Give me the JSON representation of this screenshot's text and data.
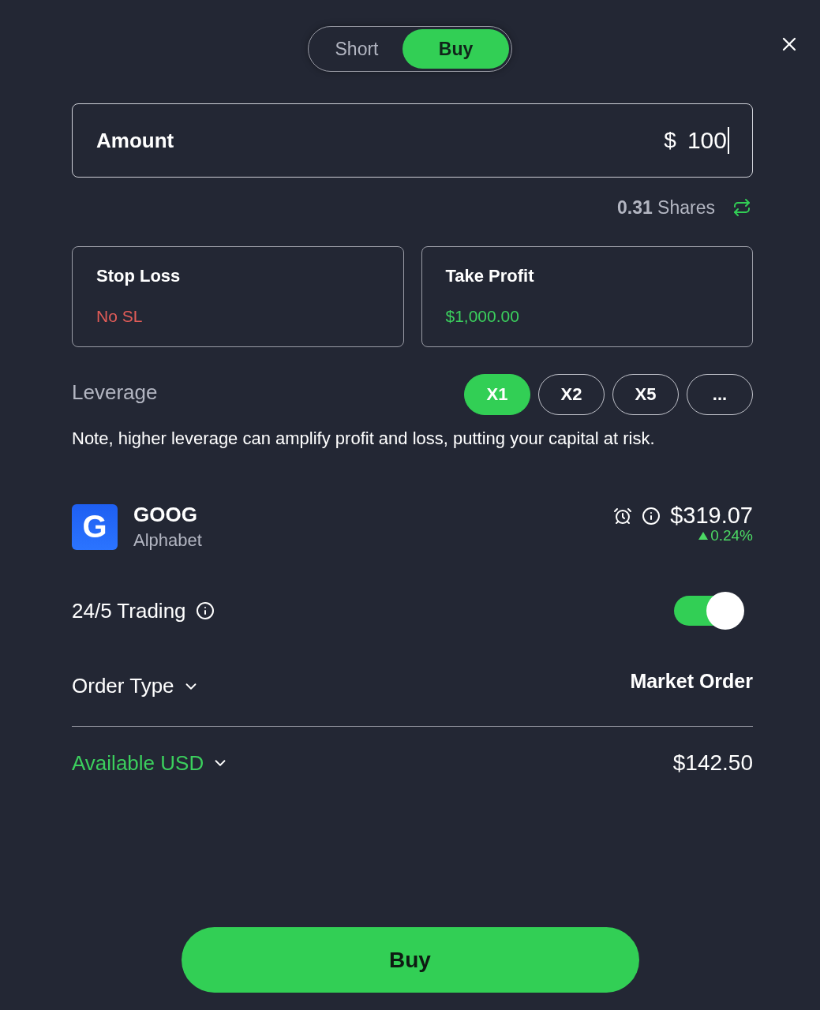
{
  "side_toggle": [
    {
      "label": "Short",
      "selected": false
    },
    {
      "label": "Buy",
      "selected": true
    }
  ],
  "amount": {
    "label": "Amount",
    "currency": "$",
    "value": "100",
    "focused": true
  },
  "shares": {
    "text": "**0.31** Shares"
  },
  "orders": [
    {
      "kind": "stop_loss",
      "title": "Stop Loss",
      "value": "No SL"
    },
    {
      "kind": "take_profit",
      "title": "Take Profit",
      "value": "$1,000.00"
    }
  ],
  "leverage": {
    "label": "Leverage",
    "options": [
      {
        "label": "X1",
        "selected": true
      },
      {
        "label": "X2",
        "selected": false
      },
      {
        "label": "X5",
        "selected": false
      },
      {
        "label": "...",
        "selected": false
      }
    ],
    "note": "Note, higher leverage can amplify profit and loss, putting your capital at risk."
  },
  "instrument": {
    "logo_letter": "G",
    "symbol": "GOOG",
    "name": "Alphabet",
    "price": "$319.07",
    "change": "0.24%",
    "rising": true
  },
  "trading_24_5": {
    "label": "24/5 Trading",
    "on": true
  },
  "order_type": {
    "label": "Order Type",
    "value": "Market Order"
  },
  "available": {
    "label": "Available USD",
    "value": "$142.50"
  },
  "submit": {
    "label": "Buy"
  }
}
